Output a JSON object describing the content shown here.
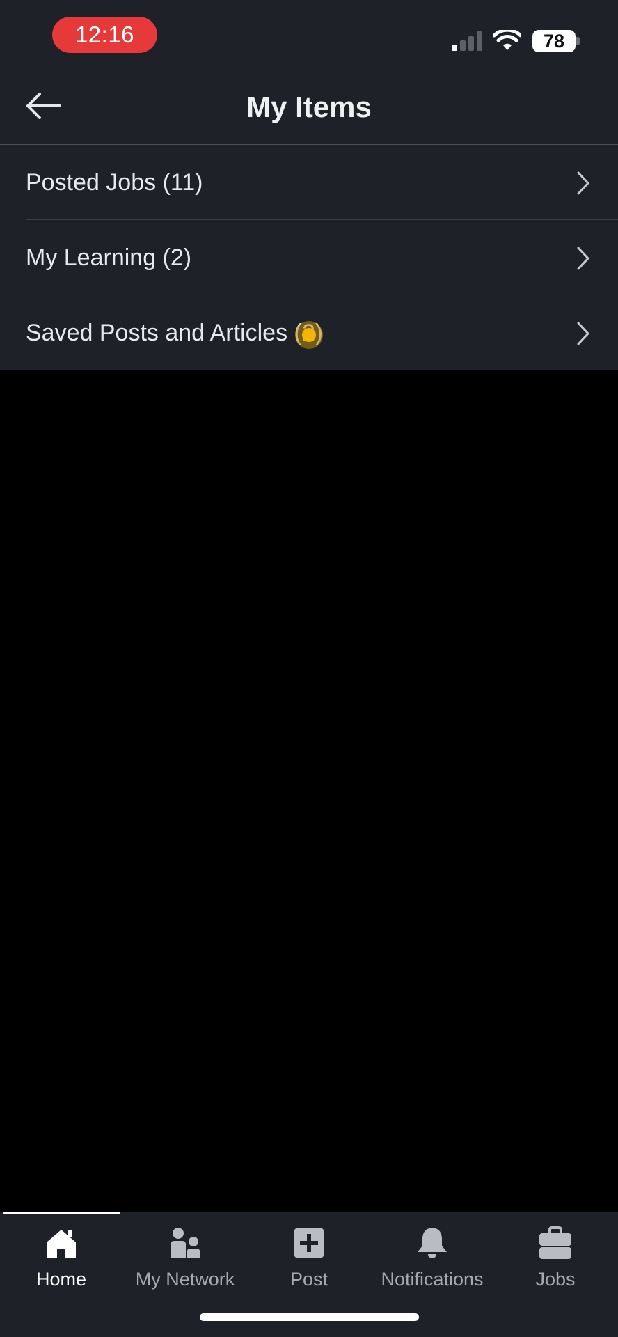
{
  "status_bar": {
    "time": "12:16",
    "battery": "78"
  },
  "header": {
    "title": "My Items"
  },
  "items": [
    {
      "label": "Posted Jobs (11)"
    },
    {
      "label": "My Learning (2)"
    },
    {
      "label": "Saved Posts and Articles (2)"
    }
  ],
  "nav": [
    {
      "label": "Home",
      "icon": "home-icon",
      "active": true
    },
    {
      "label": "My Network",
      "icon": "people-icon",
      "active": false
    },
    {
      "label": "Post",
      "icon": "plus-square-icon",
      "active": false
    },
    {
      "label": "Notifications",
      "icon": "bell-icon",
      "active": false
    },
    {
      "label": "Jobs",
      "icon": "briefcase-icon",
      "active": false
    }
  ],
  "colors": {
    "surface": "#1e2128",
    "background": "#000000",
    "time_pill": "#e5393a",
    "touch_indicator": "#f2b705"
  }
}
